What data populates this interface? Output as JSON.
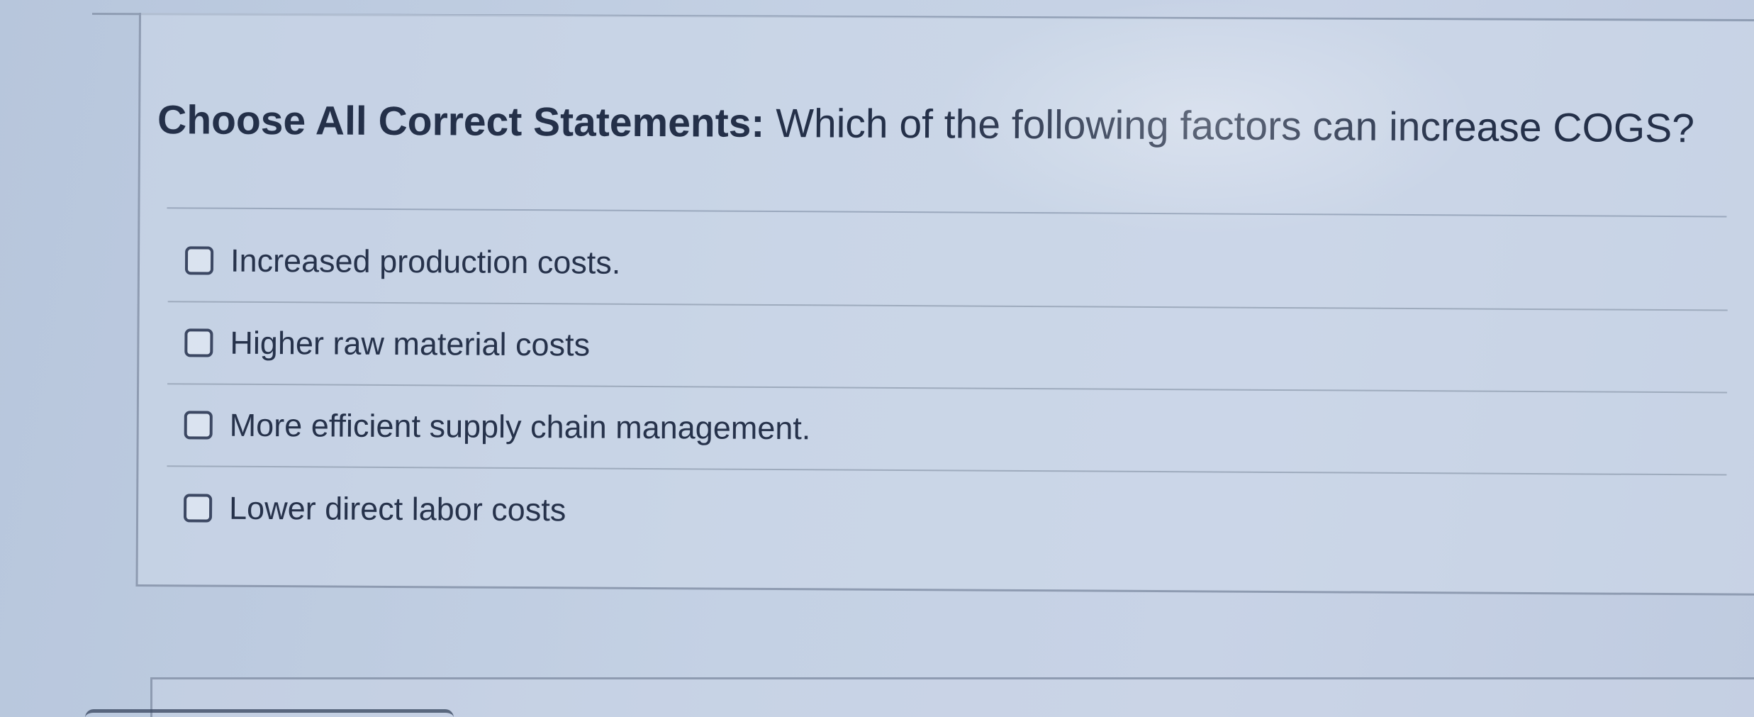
{
  "question": {
    "prefix": "Choose All Correct Statements:",
    "text": "Which of the following factors can increase COGS?"
  },
  "options": [
    {
      "label": "Increased production costs.",
      "checked": false
    },
    {
      "label": "Higher raw material costs",
      "checked": false
    },
    {
      "label": "More efficient supply chain management.",
      "checked": false
    },
    {
      "label": "Lower direct labor costs",
      "checked": false
    }
  ]
}
